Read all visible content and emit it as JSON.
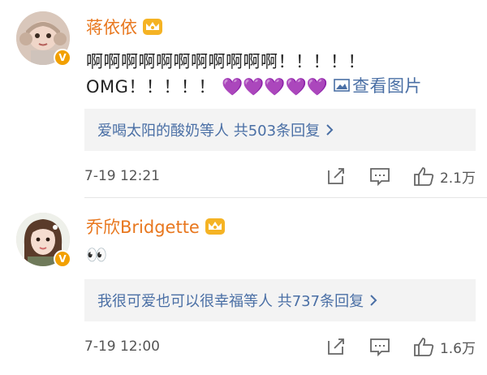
{
  "comments": [
    {
      "username": "蒋依依",
      "line1": "啊啊啊啊啊啊啊啊啊啊啊！！！！！",
      "line2_text": "OMG！！！！！",
      "hearts": "💜💜💜💜💜",
      "view_pic": "查看图片",
      "replies": "爱喝太阳的酸奶等人 共503条回复",
      "timestamp": "7-19 12:21",
      "likes": "2.1万"
    },
    {
      "username": "乔欣Bridgette",
      "line1": "👀",
      "replies": "我很可爱也可以很幸福等人 共737条回复",
      "timestamp": "7-19 12:00",
      "likes": "1.6万"
    }
  ],
  "icons": {
    "crown": "crown-icon",
    "verified": "verified-v-icon",
    "picture": "picture-icon",
    "share": "share-icon",
    "comment": "comment-icon",
    "like": "thumbs-up-icon",
    "chevron": "chevron-right-icon"
  },
  "colors": {
    "username": "#e8771e",
    "link": "#4a6fa5",
    "badge": "#f2a000",
    "heart": "#7b2fc9"
  },
  "badge_letter": "V"
}
